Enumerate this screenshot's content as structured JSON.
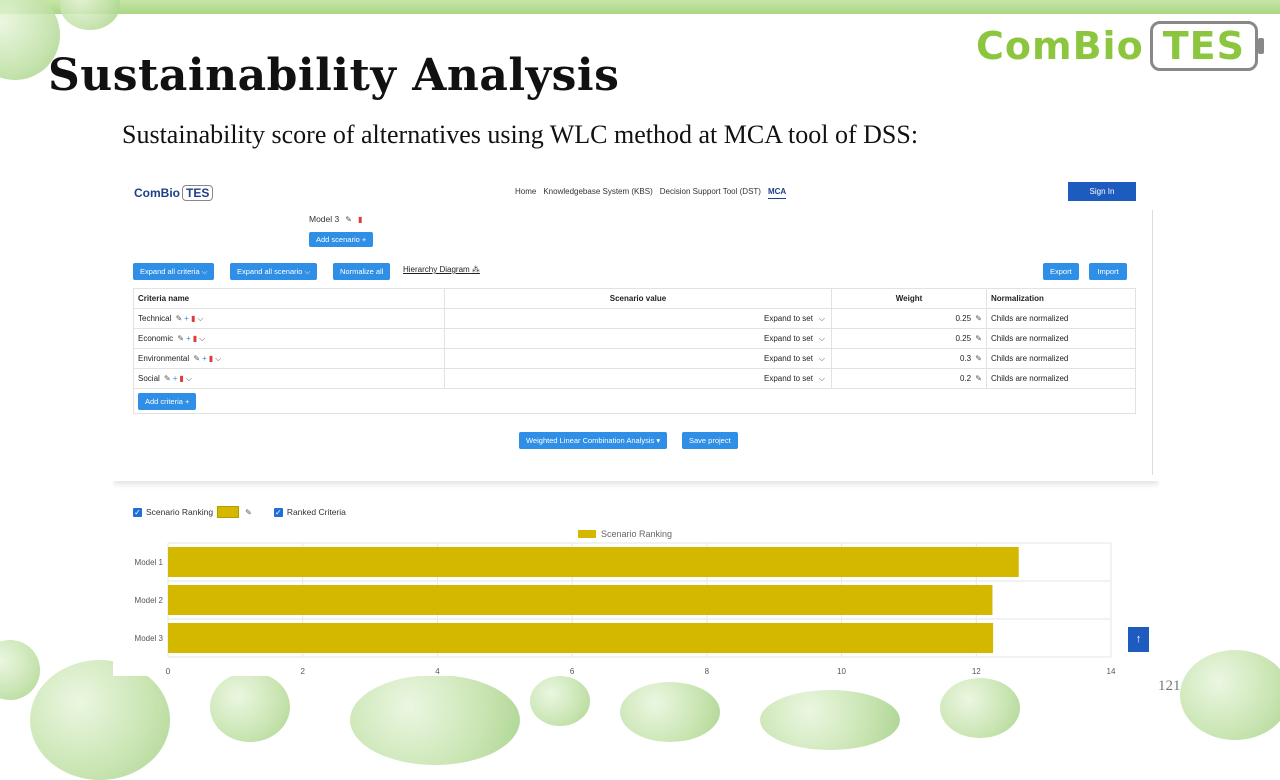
{
  "slide": {
    "title": "Sustainability Analysis",
    "subtitle": "Sustainability score of alternatives using WLC method at MCA tool of DSS:",
    "brand_left": "ComBio",
    "brand_right": "TES",
    "page_number": "121"
  },
  "app": {
    "logo_left": "ComBio",
    "logo_right": "TES",
    "nav": [
      "Home",
      "Knowledgebase System (KBS)",
      "Decision Support Tool (DST)",
      "MCA"
    ],
    "sign_in": "Sign In",
    "model_label": "Model 3",
    "add_scenario": "Add scenario +",
    "toolbar": {
      "expand_criteria": "Expand all criteria ⌵",
      "expand_scenario": "Expand all scenario ⌵",
      "normalize": "Normalize all",
      "hierarchy": "Hierarchy Diagram",
      "export": "Export",
      "import": "Import"
    },
    "table": {
      "headers": [
        "Criteria name",
        "Scenario value",
        "Weight",
        "Normalization"
      ],
      "rows": [
        {
          "name": "Technical",
          "scenario": "Expand to set",
          "weight": "0.25",
          "norm": "Childs are normalized"
        },
        {
          "name": "Economic",
          "scenario": "Expand to set",
          "weight": "0.25",
          "norm": "Childs are normalized"
        },
        {
          "name": "Environmental",
          "scenario": "Expand to set",
          "weight": "0.3",
          "norm": "Childs are normalized"
        },
        {
          "name": "Social",
          "scenario": "Expand to set",
          "weight": "0.2",
          "norm": "Childs are normalized"
        }
      ],
      "add_criteria": "Add criteria +"
    },
    "analysis_button": "Weighted Linear Combination Analysis ▾",
    "save_button": "Save project",
    "checks": {
      "scenario_ranking": "Scenario Ranking",
      "ranked_criteria": "Ranked Criteria"
    },
    "scroll_top_icon": "arrow-up-icon"
  },
  "chart_data": {
    "type": "bar",
    "orientation": "horizontal",
    "categories": [
      "Model 1",
      "Model 2",
      "Model 3"
    ],
    "series": [
      {
        "name": "Scenario Ranking",
        "values": [
          12.63,
          12.24,
          12.25
        ],
        "color": "#d4b800"
      }
    ],
    "xlim": [
      0,
      14
    ],
    "xticks": [
      0,
      2,
      4,
      6,
      8,
      10,
      12,
      14
    ],
    "legend": "top",
    "grid": true
  }
}
